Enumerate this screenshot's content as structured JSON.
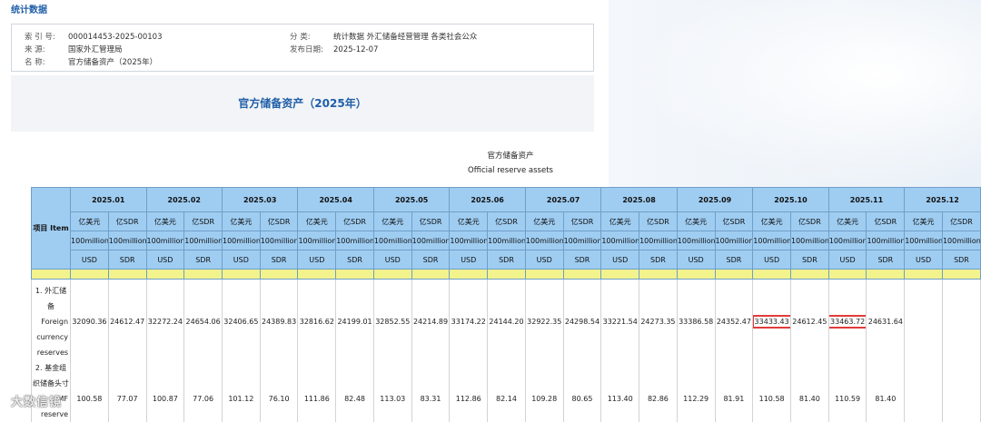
{
  "header": {
    "site_title": "统计数据"
  },
  "meta": {
    "index_label": "索 引 号:",
    "index_value": "000014453-2025-00103",
    "category_label": "分      类:",
    "category_value": "统计数据  外汇储备经营管理  各类社会公众",
    "source_label": "来      源:",
    "source_value": "国家外汇管理局",
    "date_label": "发布日期:",
    "date_value": "2025-12-07",
    "name_label": "名      称:",
    "name_value": "官方储备资产（2025年）"
  },
  "document": {
    "title": "官方储备资产（2025年）",
    "caption_zh": "官方储备资产",
    "caption_en": "Official reserve assets"
  },
  "table": {
    "item_header": "项目 Item",
    "months": [
      "2025.01",
      "2025.02",
      "2025.03",
      "2025.04",
      "2025.05",
      "2025.06",
      "2025.07",
      "2025.08",
      "2025.09",
      "2025.10",
      "2025.11",
      "2025.12"
    ],
    "unit_usd": [
      "亿美元",
      "100million",
      "USD"
    ],
    "unit_sdr": [
      "亿SDR",
      "100million",
      "SDR"
    ],
    "row1": {
      "label_lines": [
        "1. 外汇储",
        "备",
        "Foreign",
        "currency",
        "reserves"
      ],
      "values": [
        "32090.36",
        "24612.47",
        "32272.24",
        "24654.06",
        "32406.65",
        "24389.83",
        "32816.62",
        "24199.01",
        "32852.55",
        "24214.89",
        "33174.22",
        "24144.20",
        "32922.35",
        "24298.54",
        "33221.54",
        "24273.35",
        "33386.58",
        "24352.47",
        "33433.43",
        "24612.45",
        "33463.72",
        "24631.64",
        "",
        ""
      ],
      "highlighted": [
        18,
        20
      ]
    },
    "row2": {
      "label_lines": [
        "2. 基金组",
        "织储备头寸",
        "IMF",
        "reserve"
      ],
      "values": [
        "100.58",
        "77.07",
        "100.87",
        "77.06",
        "101.12",
        "76.10",
        "111.86",
        "82.48",
        "113.03",
        "83.31",
        "112.86",
        "82.14",
        "109.28",
        "80.65",
        "113.40",
        "82.86",
        "112.29",
        "81.91",
        "110.58",
        "81.40",
        "110.59",
        "81.40",
        "",
        ""
      ]
    }
  },
  "watermark": "大数信镜",
  "chart_data": {
    "type": "table",
    "title": "官方储备资产（2025年）",
    "columns": [
      "2025.01",
      "2025.02",
      "2025.03",
      "2025.04",
      "2025.05",
      "2025.06",
      "2025.07",
      "2025.08",
      "2025.09",
      "2025.10",
      "2025.11",
      "2025.12"
    ],
    "series": [
      {
        "name": "1. 外汇储备 Foreign currency reserves (亿美元)",
        "values": [
          32090.36,
          32272.24,
          32406.65,
          32816.62,
          32852.55,
          33174.22,
          32922.35,
          33221.54,
          33386.58,
          33433.43,
          33463.72,
          null
        ]
      },
      {
        "name": "1. 外汇储备 Foreign currency reserves (亿SDR)",
        "values": [
          24612.47,
          24654.06,
          24389.83,
          24199.01,
          24214.89,
          24144.2,
          24298.54,
          24273.35,
          24352.47,
          24612.45,
          24631.64,
          null
        ]
      },
      {
        "name": "2. 基金组织储备头寸 IMF reserve (亿美元)",
        "values": [
          100.58,
          100.87,
          101.12,
          111.86,
          113.03,
          112.86,
          109.28,
          113.4,
          112.29,
          110.58,
          110.59,
          null
        ]
      },
      {
        "name": "2. 基金组织储备头寸 IMF reserve (亿SDR)",
        "values": [
          77.07,
          77.06,
          76.1,
          82.48,
          83.31,
          82.14,
          80.65,
          82.86,
          81.91,
          81.4,
          81.4,
          null
        ]
      }
    ]
  }
}
